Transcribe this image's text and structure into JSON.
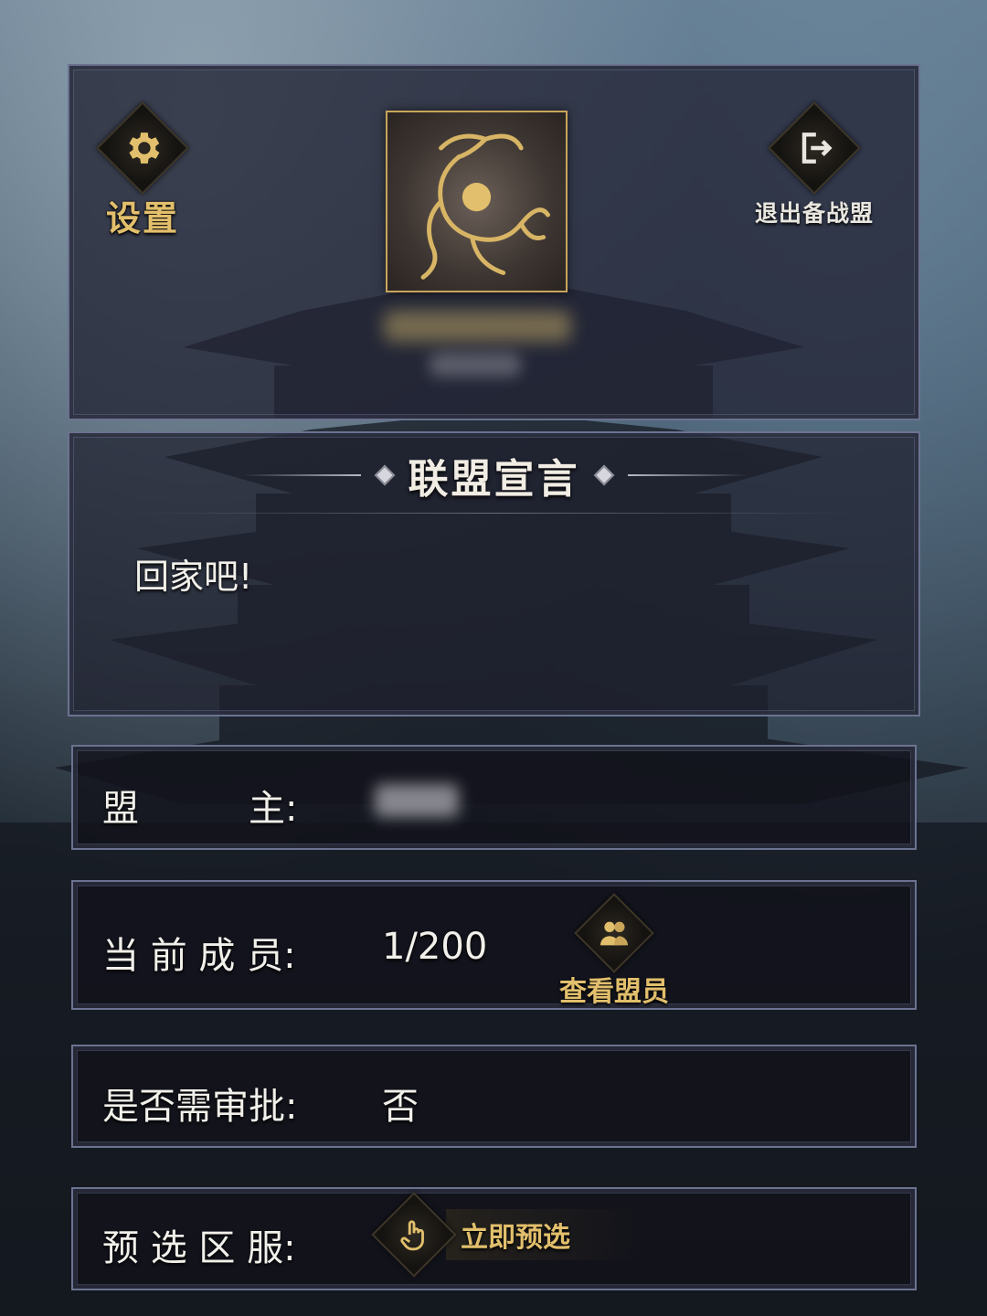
{
  "header": {
    "settings_label": "设置",
    "exit_label": "退出备战盟"
  },
  "declaration": {
    "title": "联盟宣言",
    "text": "回家吧!"
  },
  "info": {
    "leader_label": "盟　　　主:",
    "members_label": "当 前 成 员:",
    "members_value": "1/200",
    "view_members_label": "查看盟员",
    "approval_label": "是否需审批:",
    "approval_value": "否",
    "region_label": "预 选 区 服:",
    "preselect_label": "立即预选"
  },
  "icons": {
    "settings": "gear-icon",
    "exit": "exit-icon",
    "emblem": "dragon-emblem",
    "members": "members-icon",
    "preselect": "hand-pointer-icon"
  },
  "colors": {
    "gold": "#e2bf6c",
    "border": "#6b7390"
  }
}
